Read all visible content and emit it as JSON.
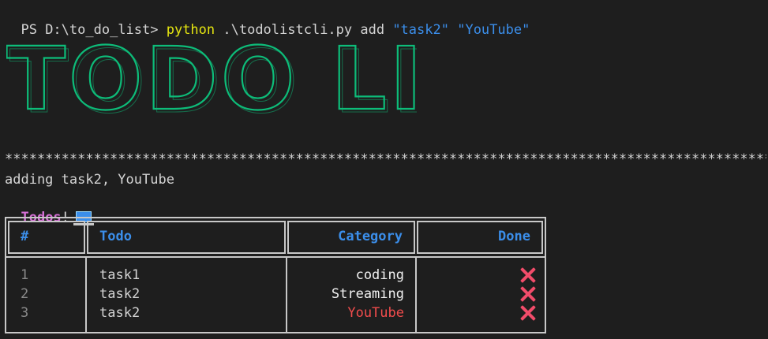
{
  "terminal": {
    "prompt": "PS D:\\to_do_list> ",
    "command": "python",
    "args": " .\\todolistcli.py add ",
    "arg_task": "\"task2\"",
    "arg_space": " ",
    "arg_category": "\"YouTube\""
  },
  "banner": {
    "text": "TODO LIST",
    "color": "#0dbc79"
  },
  "divider": "*************************************************************************************************************************************************",
  "messages": {
    "adding": "adding task2, YouTube",
    "todos_title": "Todos",
    "todos_suffix": "!",
    "todos_icon": "laptop-icon"
  },
  "table": {
    "headers": [
      "#",
      "Todo",
      "Category",
      "Done"
    ],
    "rows": [
      {
        "num": "1",
        "todo": "task1",
        "category": "coding",
        "category_color": "#f2f2f2",
        "done": "✕"
      },
      {
        "num": "2",
        "todo": "task2",
        "category": "Streaming",
        "category_color": "#f2f2f2",
        "done": "✕"
      },
      {
        "num": "3",
        "todo": "task2",
        "category": "YouTube",
        "category_color": "#f14c4c",
        "done": "✕"
      }
    ]
  },
  "colors": {
    "background": "#1e1e1e",
    "header_text": "#3b8eea",
    "todos_title": "#d670d6",
    "done_icon": "#f14c6a"
  }
}
